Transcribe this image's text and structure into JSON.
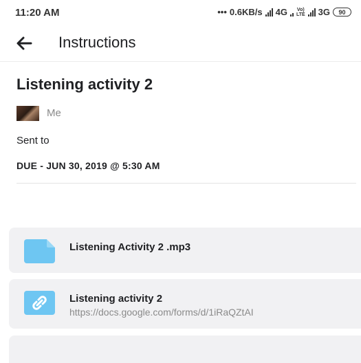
{
  "status_bar": {
    "time": "11:20 AM",
    "net_speed": "0.6KB/s",
    "network_1": "4G",
    "lte_top": "Vo)",
    "lte_bottom": "LTE",
    "network_2": "3G",
    "battery": "90"
  },
  "app_bar": {
    "back_icon": "arrow-left-icon",
    "title": "Instructions"
  },
  "assignment": {
    "title": "Listening activity 2",
    "author": "Me",
    "sent_to_label": "Sent to",
    "due": "DUE - JUN 30, 2019 @ 5:30 AM"
  },
  "attachments": [
    {
      "icon": "file-icon",
      "label": "Listening Activity 2 .mp3"
    },
    {
      "icon": "link-icon",
      "label": "Listening activity 2",
      "url": "https://docs.google.com/forms/d/1iRaQZtAI"
    }
  ],
  "colors": {
    "icon_blue": "#6ec6f2",
    "card_bg": "#f1f1f3",
    "muted_text": "#8a8a8a"
  }
}
